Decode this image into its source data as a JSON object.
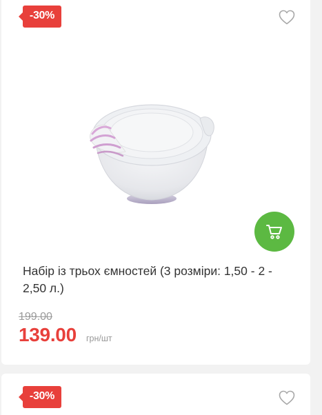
{
  "colors": {
    "discount_badge": "#e8403b",
    "cart_button": "#5cb942",
    "price": "#e8403b"
  },
  "products": [
    {
      "discount": "-30%",
      "title": "Набір із трьох ємностей (3 розміри: 1,50 - 2 - 2,50 л.)",
      "old_price": "199.00",
      "price": "139.00",
      "unit": "грн/шт",
      "wishlist_icon": "heart-outline-icon",
      "cart_icon": "shopping-cart-icon"
    },
    {
      "discount": "-30%",
      "wishlist_icon": "heart-outline-icon"
    }
  ]
}
